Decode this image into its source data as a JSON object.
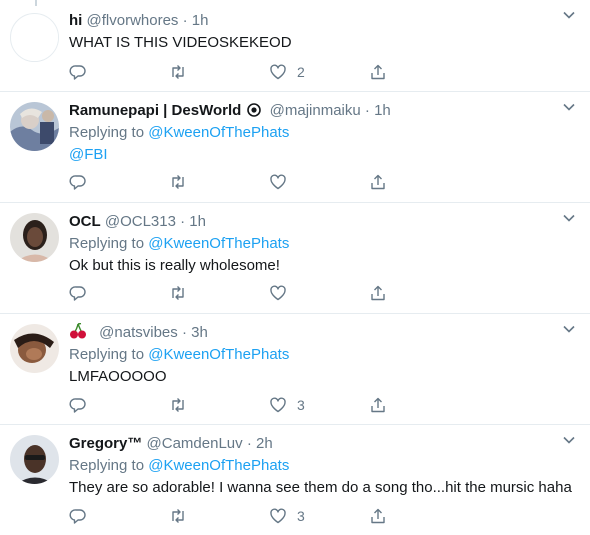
{
  "tweets": [
    {
      "name": "hi",
      "handle": "@flvorwhores",
      "time": "1h",
      "replying_label": "",
      "replying_to": "",
      "text": "WHAT IS THIS VIDEOSKEKEOD",
      "replies": "",
      "retweets": "",
      "likes": "2"
    },
    {
      "name": "Ramunepapi | DesWorld",
      "handle": "@majinmaiku",
      "time": "1h",
      "replying_label": "Replying to",
      "replying_to": "@KweenOfThePhats",
      "text": "@FBI",
      "replies": "",
      "retweets": "",
      "likes": ""
    },
    {
      "name": "OCL",
      "handle": "@OCL313",
      "time": "1h",
      "replying_label": "Replying to",
      "replying_to": "@KweenOfThePhats",
      "text": "Ok but this is really wholesome!",
      "replies": "",
      "retweets": "",
      "likes": ""
    },
    {
      "name": "",
      "handle": "@natsvibes",
      "time": "3h",
      "replying_label": "Replying to",
      "replying_to": "@KweenOfThePhats",
      "text": "LMFAOOOOO",
      "replies": "",
      "retweets": "",
      "likes": "3"
    },
    {
      "name": "Gregory™",
      "handle": "@CamdenLuv",
      "time": "2h",
      "replying_label": "Replying to",
      "replying_to": "@KweenOfThePhats",
      "text": "They are so adorable! I wanna see them do a song tho...hit the mursic haha",
      "replies": "",
      "retweets": "",
      "likes": "3"
    }
  ],
  "separator": "·",
  "icons": {
    "reply": "reply-icon",
    "retweet": "retweet-icon",
    "like": "heart-icon",
    "share": "share-icon",
    "caret": "chevron-down-icon"
  },
  "colors": {
    "text": "#14171a",
    "secondary": "#657786",
    "link": "#1da1f2",
    "border": "#e6ecf0"
  }
}
